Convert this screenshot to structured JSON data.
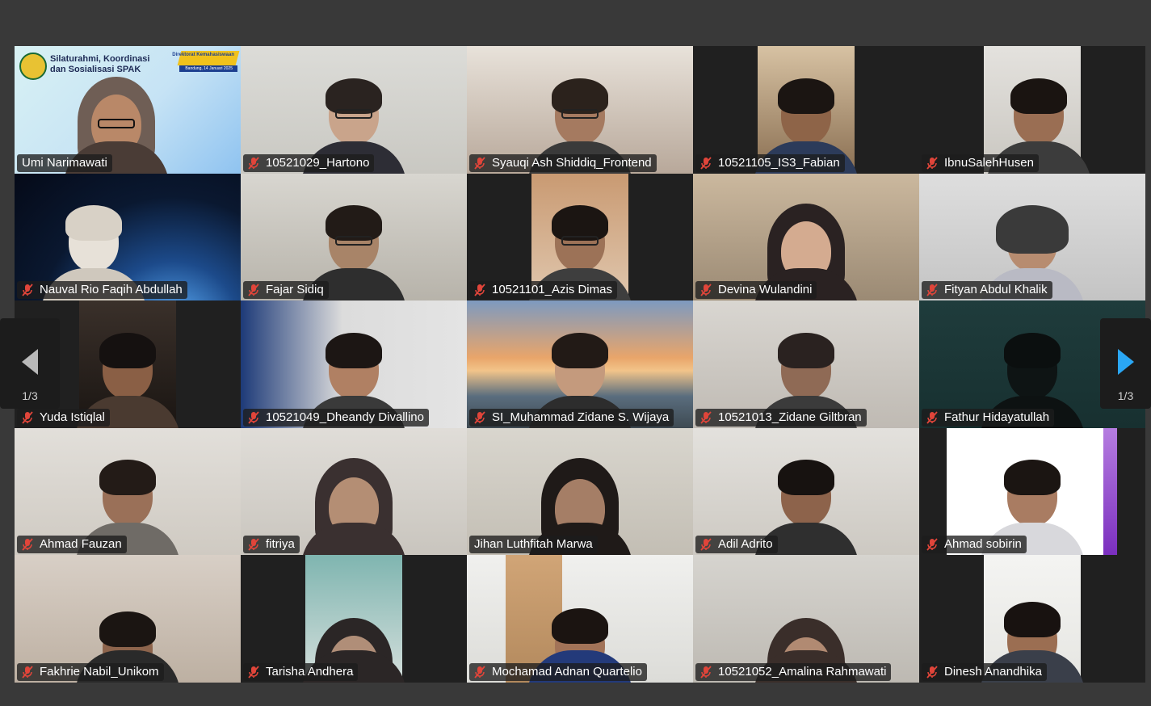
{
  "navigation": {
    "prev_page": "1/3",
    "next_page": "1/3"
  },
  "colors": {
    "active_speaker_border": "#23d959",
    "next_arrow": "#2aa7f5",
    "prev_arrow": "#b9b9b9"
  },
  "presentation": {
    "title_line1": "Silaturahmi, Koordinasi",
    "title_line2": "dan Sosialisasi SPAK",
    "ribbon_title": "Direktorat Kemahasiswaan",
    "ribbon_sub": "Bandung, 14 Januari 2025"
  },
  "participants": [
    {
      "name": "Umi Narimawati",
      "muted": false
    },
    {
      "name": "10521029_Hartono",
      "muted": true
    },
    {
      "name": "Syauqi Ash Shiddiq_Frontend",
      "muted": true
    },
    {
      "name": "10521105_IS3_Fabian",
      "muted": true
    },
    {
      "name": "IbnuSalehHusen",
      "muted": true
    },
    {
      "name": "Nauval Rio Faqih Abdullah",
      "muted": true
    },
    {
      "name": "Fajar Sidiq",
      "muted": true
    },
    {
      "name": "10521101_Azis Dimas",
      "muted": true
    },
    {
      "name": "Devina Wulandini",
      "muted": true
    },
    {
      "name": "Fityan Abdul Khalik",
      "muted": true
    },
    {
      "name": "Yuda Istiqlal",
      "muted": true
    },
    {
      "name": "10521049_Dheandy Divallino",
      "muted": true
    },
    {
      "name": "SI_Muhammad Zidane S. Wijaya",
      "muted": true
    },
    {
      "name": "10521013_Zidane Giltbran",
      "muted": true
    },
    {
      "name": "Fathur Hidayatullah",
      "muted": true
    },
    {
      "name": "Ahmad Fauzan",
      "muted": true
    },
    {
      "name": "fitriya",
      "muted": true
    },
    {
      "name": "Jihan Luthfitah Marwa",
      "muted": false
    },
    {
      "name": "Adil Adrito",
      "muted": true
    },
    {
      "name": "Ahmad sobirin",
      "muted": true
    },
    {
      "name": "Fakhrie Nabil_Unikom",
      "muted": true
    },
    {
      "name": "Tarisha Andhera",
      "muted": true
    },
    {
      "name": "Mochamad Adnan Quartelio",
      "muted": true
    },
    {
      "name": "10521052_Amalina Rahmawati",
      "muted": true
    },
    {
      "name": "Dinesh Anandhika",
      "muted": true
    }
  ]
}
